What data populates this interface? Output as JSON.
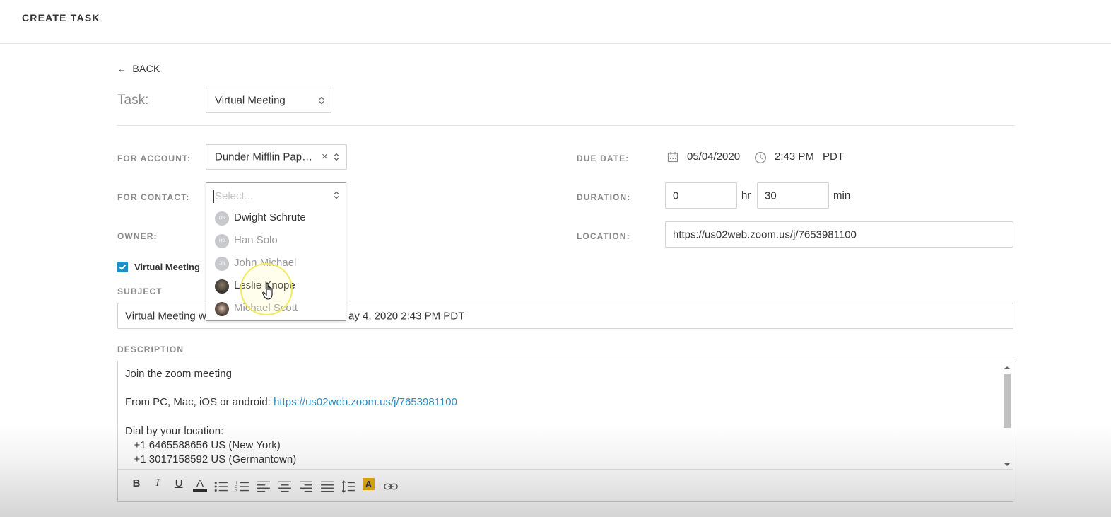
{
  "header": {
    "title": "CREATE TASK"
  },
  "back": {
    "label": "BACK"
  },
  "task": {
    "label": "Task:",
    "value": "Virtual Meeting"
  },
  "form": {
    "for_account_label": "FOR ACCOUNT:",
    "for_account_value": "Dunder Mifflin Pap…",
    "for_contact_label": "FOR CONTACT:",
    "owner_label": "OWNER:",
    "due_date_label": "DUE DATE:",
    "due_date": "05/04/2020",
    "due_time": "2:43 PM",
    "timezone": "PDT",
    "duration_label": "DURATION:",
    "duration_hr": "0",
    "hr_unit": "hr",
    "duration_min": "30",
    "min_unit": "min",
    "location_label": "LOCATION:",
    "location_value": "https://us02web.zoom.us/j/7653981100",
    "virtual_meeting_checkbox": "Virtual Meeting",
    "virtual_meeting_checked": true,
    "subject_label": "SUBJECT",
    "subject_prefix": "Virtual Meeting w",
    "subject_suffix": "ay 4, 2020 2:43 PM PDT",
    "description_label": "DESCRIPTION"
  },
  "contact_dropdown": {
    "placeholder": "Select...",
    "items": [
      {
        "name": "Dwight Schrute",
        "initials": "DS",
        "avatar": "initials",
        "state": "normal"
      },
      {
        "name": "Han Solo",
        "initials": "HS",
        "avatar": "initials",
        "state": "muted"
      },
      {
        "name": "John Michael",
        "initials": "JM",
        "avatar": "initials",
        "state": "muted"
      },
      {
        "name": "Leslie Knope",
        "initials": "",
        "avatar": "photo",
        "state": "hovered"
      },
      {
        "name": "Michael Scott",
        "initials": "",
        "avatar": "photo",
        "state": "muted"
      }
    ]
  },
  "description": {
    "line1": "Join the zoom meeting",
    "line2_prefix": "From PC, Mac, iOS or android: ",
    "line2_link": "https://us02web.zoom.us/j/7653981100",
    "line3": "Dial by your location:",
    "line4": "   +1 6465588656 US (New York)",
    "line5": "   +1 3017158592 US (Germantown)"
  },
  "toolbar": {
    "buttons": [
      "bold-icon",
      "italic-icon",
      "underline-icon",
      "font-color-icon",
      "bullet-list-icon",
      "numbered-list-icon",
      "align-left-icon",
      "align-center-icon",
      "align-right-icon",
      "justify-icon",
      "line-height-icon",
      "highlight-icon",
      "link-icon"
    ],
    "bold": "B",
    "italic": "I",
    "underline": "U",
    "font_color": "A",
    "highlight": "A"
  },
  "colors": {
    "accent": "#1f8fc6",
    "link": "#2a8bc0",
    "highlight": "#e8b10f"
  }
}
